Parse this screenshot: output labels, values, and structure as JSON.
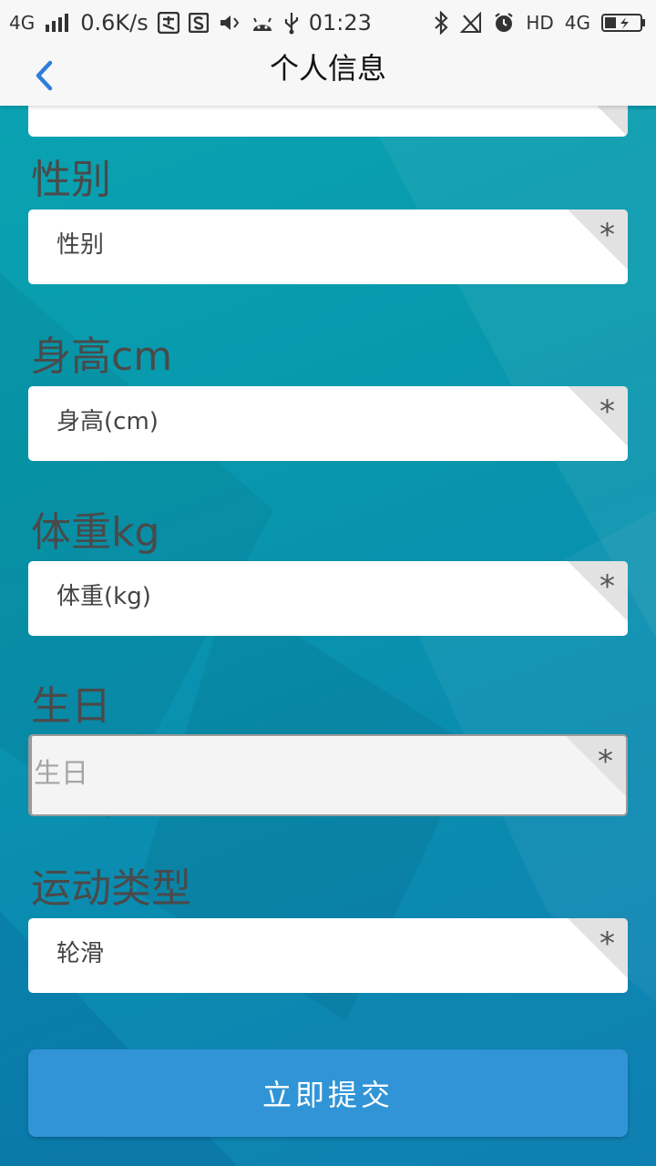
{
  "status_bar": {
    "network": "4G",
    "speed": "0.6K/s",
    "time": "01:23",
    "hd": "HD",
    "network_right": "4G",
    "icons_left": [
      "signal-icon",
      "payment-icon",
      "s-app-icon",
      "vibrate-icon",
      "android-icon",
      "usb-icon"
    ],
    "icons_right": [
      "bluetooth-icon",
      "signal-off-icon",
      "alarm-icon",
      "battery-charging-icon"
    ]
  },
  "header": {
    "title": "个人信息",
    "back_icon": "chevron-left-icon",
    "accent_color": "#2d7fd8"
  },
  "form": {
    "fields": [
      {
        "label": "性别",
        "value": "性别",
        "required_mark": "*"
      },
      {
        "label": "身高cm",
        "value": "身高(cm)",
        "required_mark": "*"
      },
      {
        "label": "体重kg",
        "value": "体重(kg)",
        "required_mark": "*"
      },
      {
        "label": "生日",
        "placeholder": "生日",
        "required_mark": "*"
      },
      {
        "label": "运动类型",
        "value": "轮滑",
        "required_mark": "*"
      }
    ],
    "submit_label": "立即提交",
    "submit_color": "#3194d6"
  }
}
